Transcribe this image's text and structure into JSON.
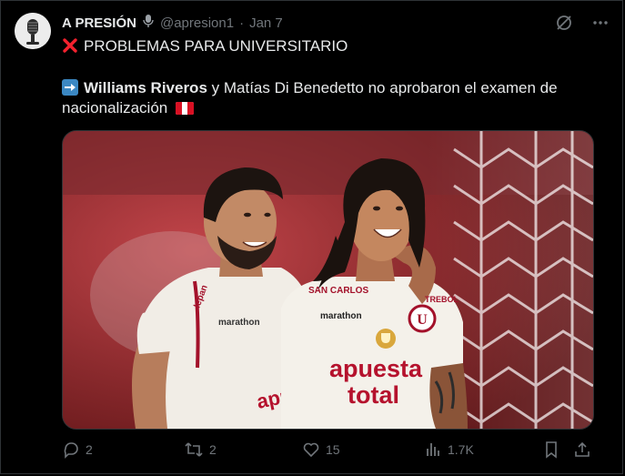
{
  "tweet": {
    "author_name": "A PRESIÓN",
    "handle": "@apresion1",
    "separator": "·",
    "date": "Jan 7",
    "line1": "PROBLEMAS PARA UNIVERSITARIO",
    "line2_bold": "Williams Riveros",
    "line2_rest": " y Matías Di Benedetto no aprobaron el examen de",
    "line3": "nacionalización"
  },
  "media": {
    "sponsor_main": "apuesta",
    "sponsor_sub": "total",
    "left_sponsor": "apuesta total",
    "left_chest": "marathon",
    "chest_brand": "marathon",
    "shoulder_left": "SAN CARLOS",
    "shoulder_right": "TREBOL"
  },
  "actions": {
    "replies": "2",
    "reposts": "2",
    "likes": "15",
    "views": "1.7K"
  },
  "colors": {
    "background": "#000000",
    "text": "#e7e9ea",
    "muted": "#71767b",
    "cross": "#f4212e",
    "arrow_bg": "#3b88c3"
  }
}
